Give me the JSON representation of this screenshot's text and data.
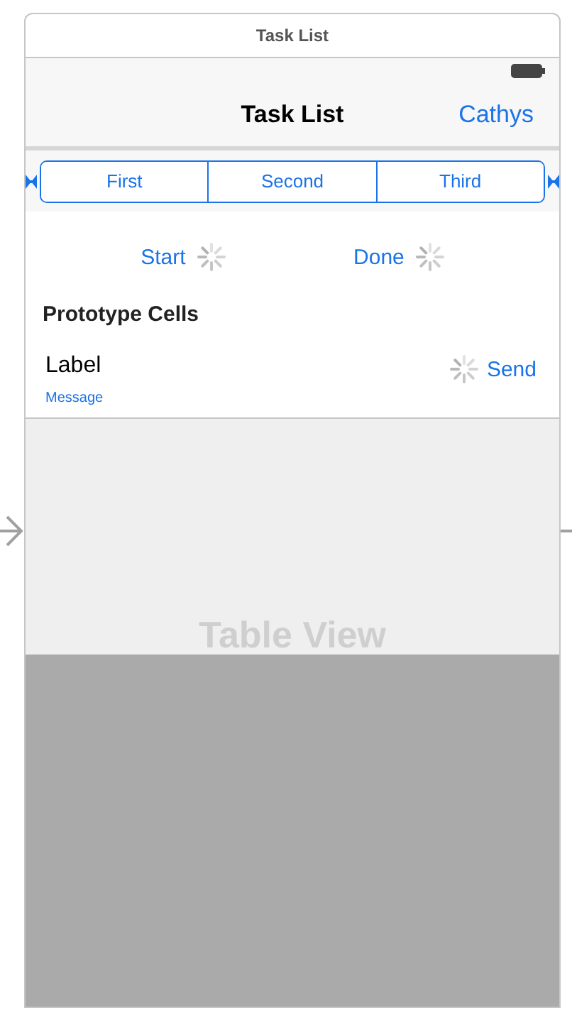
{
  "window": {
    "title": "Task List"
  },
  "nav_bar": {
    "title": "Task List",
    "right_button": "Cathys"
  },
  "segments": [
    {
      "label": "First",
      "selected": false
    },
    {
      "label": "Second",
      "selected": false
    },
    {
      "label": "Third",
      "selected": false
    }
  ],
  "actions": [
    {
      "label": "Start"
    },
    {
      "label": "Done"
    }
  ],
  "table": {
    "section_header": "Prototype Cells",
    "cell": {
      "title": "Label",
      "subtitle": "Message",
      "button": "Send"
    },
    "placeholder": "Table View"
  }
}
